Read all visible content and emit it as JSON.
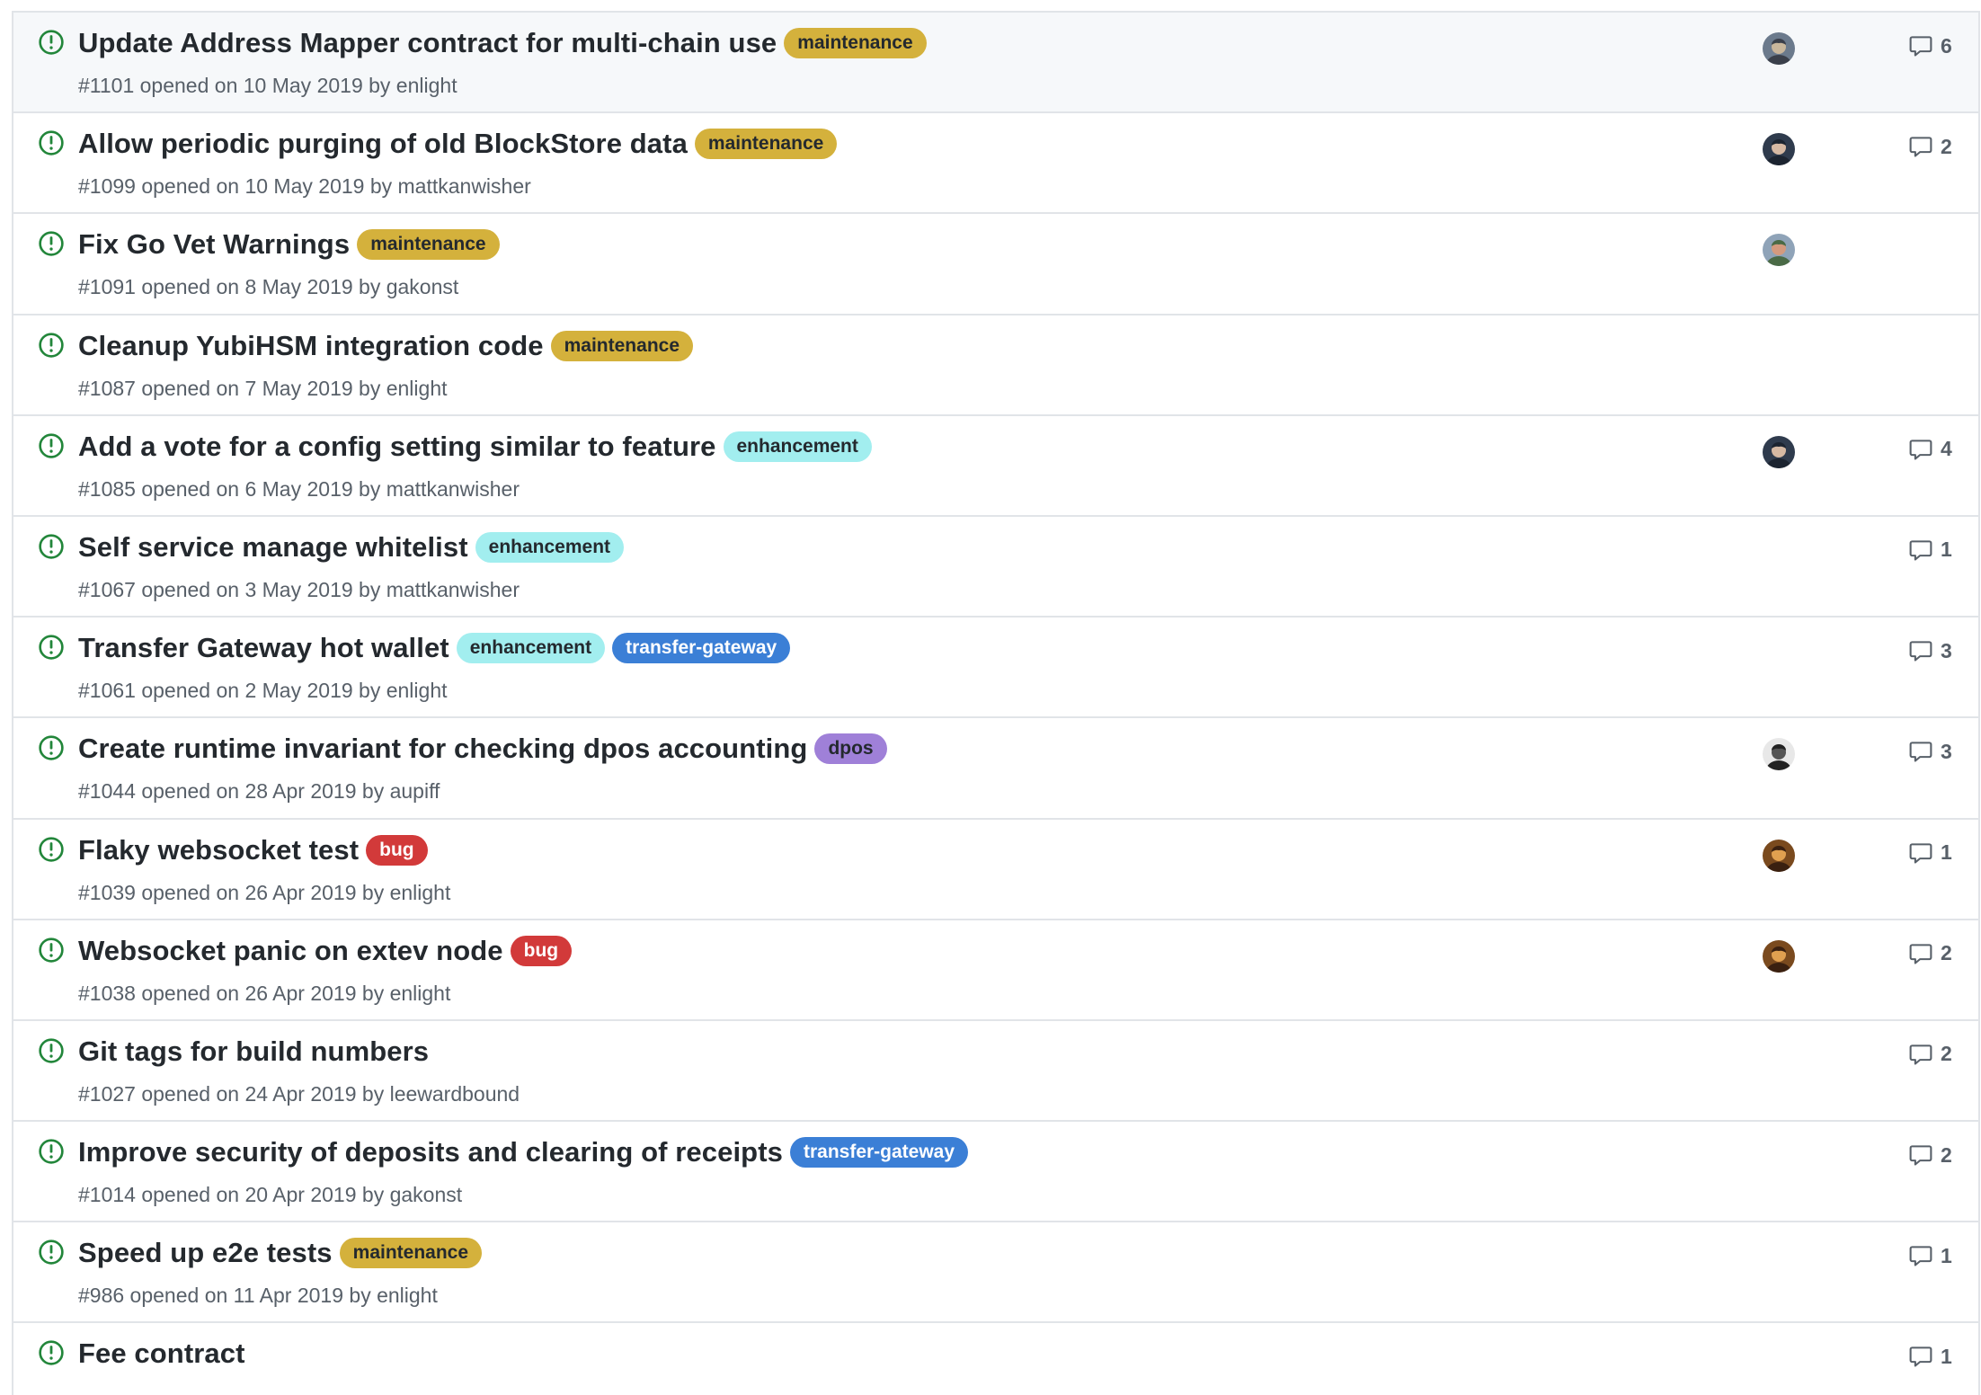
{
  "colors": {
    "open_icon": "#22863a",
    "row_border": "#e1e4e8",
    "meta_text": "#586069",
    "title_text": "#24292e",
    "highlight_row": "#f6f8fa"
  },
  "label_styles": {
    "maintenance": {
      "bg": "#d4b13c",
      "fg": "#24292e"
    },
    "enhancement": {
      "bg": "#a2eeef",
      "fg": "#24292e"
    },
    "transfer-gateway": {
      "bg": "#3b7fd6",
      "fg": "#ffffff"
    },
    "dpos": {
      "bg": "#9f80d8",
      "fg": "#24292e"
    },
    "bug": {
      "bg": "#d23a3a",
      "fg": "#ffffff"
    }
  },
  "issues": [
    {
      "title": "Update Address Mapper contract for multi-chain use",
      "labels": [
        "maintenance"
      ],
      "meta": "#1101 opened on 10 May 2019 by enlight",
      "avatar": "avatar-a",
      "comments": "6",
      "highlight": true
    },
    {
      "title": "Allow periodic purging of old BlockStore data",
      "labels": [
        "maintenance"
      ],
      "meta": "#1099 opened on 10 May 2019 by mattkanwisher",
      "avatar": "avatar-b",
      "comments": "2"
    },
    {
      "title": "Fix Go Vet Warnings",
      "labels": [
        "maintenance"
      ],
      "meta": "#1091 opened on 8 May 2019 by gakonst",
      "avatar": "avatar-c",
      "comments": ""
    },
    {
      "title": "Cleanup YubiHSM integration code",
      "labels": [
        "maintenance"
      ],
      "meta": "#1087 opened on 7 May 2019 by enlight",
      "avatar": "",
      "comments": ""
    },
    {
      "title": "Add a vote for a config setting similar to feature",
      "labels": [
        "enhancement"
      ],
      "meta": "#1085 opened on 6 May 2019 by mattkanwisher",
      "avatar": "avatar-b",
      "comments": "4"
    },
    {
      "title": "Self service manage whitelist",
      "labels": [
        "enhancement"
      ],
      "meta": "#1067 opened on 3 May 2019 by mattkanwisher",
      "avatar": "",
      "comments": "1"
    },
    {
      "title": "Transfer Gateway hot wallet",
      "labels": [
        "enhancement",
        "transfer-gateway"
      ],
      "meta": "#1061 opened on 2 May 2019 by enlight",
      "avatar": "",
      "comments": "3"
    },
    {
      "title": "Create runtime invariant for checking dpos accounting",
      "labels": [
        "dpos"
      ],
      "meta": "#1044 opened on 28 Apr 2019 by aupiff",
      "avatar": "avatar-d",
      "comments": "3"
    },
    {
      "title": "Flaky websocket test",
      "labels": [
        "bug"
      ],
      "meta": "#1039 opened on 26 Apr 2019 by enlight",
      "avatar": "avatar-e",
      "comments": "1"
    },
    {
      "title": "Websocket panic on extev node",
      "labels": [
        "bug"
      ],
      "meta": "#1038 opened on 26 Apr 2019 by enlight",
      "avatar": "avatar-e",
      "comments": "2"
    },
    {
      "title": "Git tags for build numbers",
      "labels": [],
      "meta": "#1027 opened on 24 Apr 2019 by leewardbound",
      "avatar": "",
      "comments": "2"
    },
    {
      "title": "Improve security of deposits and clearing of receipts",
      "labels": [
        "transfer-gateway"
      ],
      "meta": "#1014 opened on 20 Apr 2019 by gakonst",
      "avatar": "",
      "comments": "2"
    },
    {
      "title": "Speed up e2e tests",
      "labels": [
        "maintenance"
      ],
      "meta": "#986 opened on 11 Apr 2019 by enlight",
      "avatar": "",
      "comments": "1"
    },
    {
      "title": "Fee contract",
      "labels": [],
      "meta": "",
      "avatar": "",
      "comments": "1"
    }
  ],
  "avatar_palettes": {
    "avatar-a": [
      "#6b7a8c",
      "#c9b79c",
      "#3a3f4a"
    ],
    "avatar-b": [
      "#2f3b4d",
      "#d6b9a3",
      "#1c2430"
    ],
    "avatar-c": [
      "#8fa3b8",
      "#d49a7e",
      "#4a6a46"
    ],
    "avatar-d": [
      "#e8e8e8",
      "#555555",
      "#222222"
    ],
    "avatar-e": [
      "#7a4a1e",
      "#e0a050",
      "#3a2010"
    ]
  }
}
